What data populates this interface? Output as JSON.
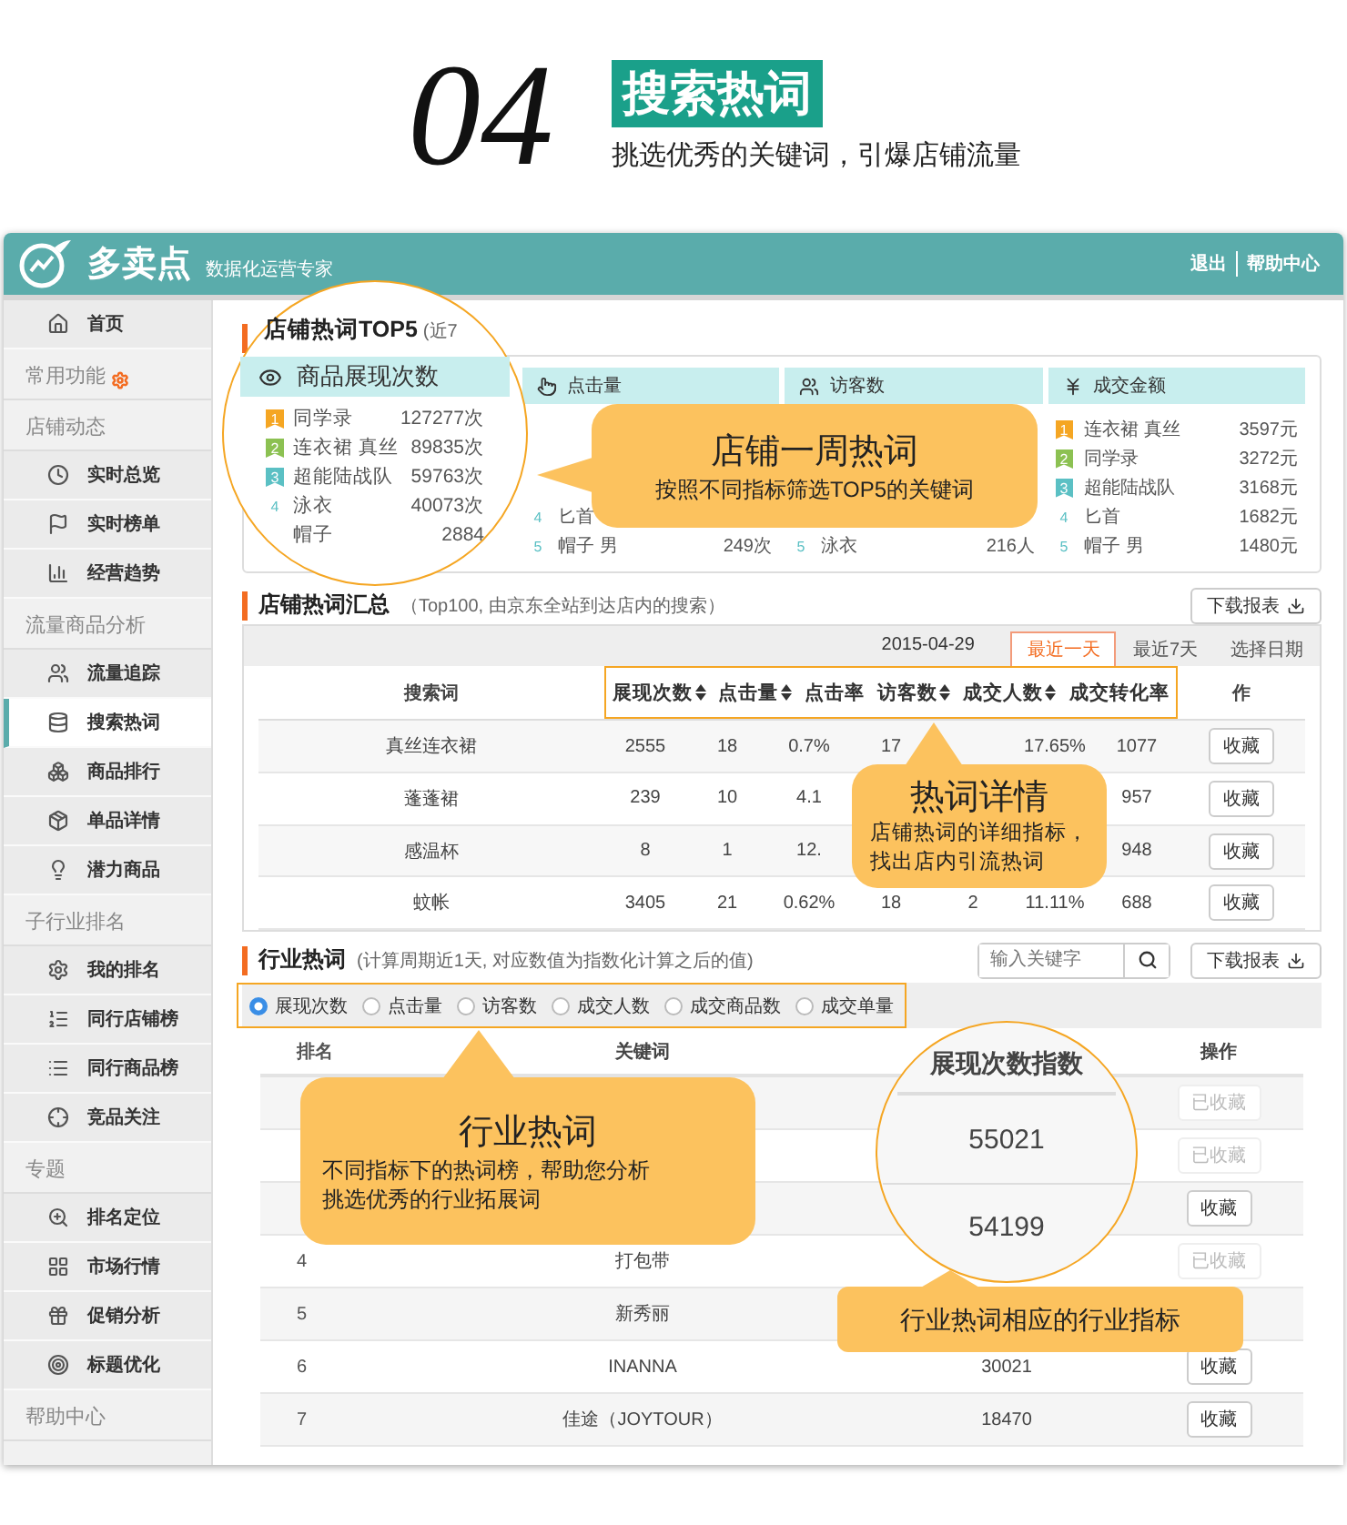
{
  "hero": {
    "number": "04",
    "title": "搜索热词",
    "subtitle": "挑选优秀的关键词，引爆店铺流量"
  },
  "topbar": {
    "brand": "多卖点",
    "tagline": "数据化运营专家",
    "links": [
      "退出",
      "帮助中心"
    ]
  },
  "sidebar": [
    {
      "kind": "item",
      "label": "首页",
      "selected": false
    },
    {
      "kind": "heading",
      "label": "常用功能",
      "gear": true
    },
    {
      "kind": "heading",
      "label": "店铺动态"
    },
    {
      "kind": "item",
      "label": "实时总览",
      "selected": false
    },
    {
      "kind": "item",
      "label": "实时榜单",
      "selected": false
    },
    {
      "kind": "item",
      "label": "经营趋势",
      "selected": false
    },
    {
      "kind": "heading",
      "label": "流量商品分析"
    },
    {
      "kind": "item",
      "label": "流量追踪",
      "selected": false
    },
    {
      "kind": "item",
      "label": "搜索热词",
      "selected": true
    },
    {
      "kind": "item",
      "label": "商品排行",
      "selected": false
    },
    {
      "kind": "item",
      "label": "单品详情",
      "selected": false
    },
    {
      "kind": "item",
      "label": "潜力商品",
      "selected": false
    },
    {
      "kind": "heading",
      "label": "子行业排名"
    },
    {
      "kind": "item",
      "label": "我的排名",
      "selected": false
    },
    {
      "kind": "item",
      "label": "同行店铺榜",
      "selected": false
    },
    {
      "kind": "item",
      "label": "同行商品榜",
      "selected": false
    },
    {
      "kind": "item",
      "label": "竞品关注",
      "selected": false
    },
    {
      "kind": "heading",
      "label": "专题"
    },
    {
      "kind": "item",
      "label": "排名定位",
      "selected": false
    },
    {
      "kind": "item",
      "label": "市场行情",
      "selected": false
    },
    {
      "kind": "item",
      "label": "促销分析",
      "selected": false
    },
    {
      "kind": "item",
      "label": "标题优化",
      "selected": false
    },
    {
      "kind": "heading",
      "label": "帮助中心"
    }
  ],
  "top5": {
    "title": "店铺热词TOP5",
    "note": "(近7",
    "columns": [
      {
        "title": "商品展现次数",
        "rows": [
          {
            "rank": "1",
            "color": "#f5a623",
            "name": "同学录",
            "value": "127277次"
          },
          {
            "rank": "2",
            "color": "#8cc152",
            "name": "连衣裙 真丝",
            "value": "89835次"
          },
          {
            "rank": "3",
            "color": "#5bc0c4",
            "name": "超能陆战队",
            "value": "59763次"
          },
          {
            "rank": "4",
            "name": "泳衣",
            "value": "40073次"
          },
          {
            "name": "帽子",
            "value": "2884"
          }
        ]
      },
      {
        "title": "点击量",
        "rows": [
          {
            "rank": "4",
            "name": "匕首"
          },
          {
            "rank": "5",
            "name": "帽子 男",
            "value": "249次"
          }
        ]
      },
      {
        "title": "访客数",
        "rows": [
          {
            "rank": "5",
            "name": "泳衣",
            "value": "216人"
          }
        ]
      },
      {
        "title": "成交金额",
        "rows": [
          {
            "rank": "1",
            "color": "#f5a623",
            "name": "连衣裙 真丝",
            "value": "3597元"
          },
          {
            "rank": "2",
            "color": "#8cc152",
            "name": "同学录",
            "value": "3272元"
          },
          {
            "rank": "3",
            "color": "#5bc0c4",
            "name": "超能陆战队",
            "value": "3168元"
          },
          {
            "rank": "4",
            "name": "匕首",
            "value": "1682元"
          },
          {
            "rank": "5",
            "name": "帽子 男",
            "value": "1480元"
          }
        ]
      }
    ],
    "callout": {
      "title": "店铺一周热词",
      "text": "按照不同指标筛选TOP5的关键词"
    }
  },
  "summary": {
    "title": "店铺热词汇总",
    "note": "（Top100, 由京东全站到达店内的搜索）",
    "download": "下载报表",
    "date": "2015-04-29",
    "ranges": [
      {
        "label": "最近一天",
        "selected": true
      },
      {
        "label": "最近7天",
        "selected": false
      },
      {
        "label": "选择日期",
        "selected": false
      }
    ],
    "keyword_header": "搜索词",
    "metric_headers": [
      {
        "label": "展现次数",
        "sortable": true
      },
      {
        "label": "点击量",
        "sortable": true
      },
      {
        "label": "点击率",
        "sortable": false
      },
      {
        "label": "访客数",
        "sortable": true
      },
      {
        "label": "成交人数",
        "sortable": true
      },
      {
        "label": "成交转化率",
        "sortable": false
      }
    ],
    "action_header": "作",
    "rows": [
      {
        "keyword": "真丝连衣裙",
        "cells": [
          "2555",
          "18",
          "0.7%",
          "17",
          null,
          "17.65%",
          "1077"
        ],
        "button": "收藏"
      },
      {
        "keyword": "蓬蓬裙",
        "cells": [
          "239",
          "10",
          "4.1",
          null,
          null,
          null,
          "957"
        ],
        "button": "收藏"
      },
      {
        "keyword": "感温杯",
        "cells": [
          "8",
          "1",
          "12.",
          null,
          null,
          null,
          "948"
        ],
        "button": "收藏"
      },
      {
        "keyword": "蚊帐",
        "cells": [
          "3405",
          "21",
          "0.62%",
          "18",
          "2",
          "11.11%",
          "688"
        ],
        "button": "收藏"
      }
    ],
    "callout": {
      "title": "热词详情",
      "text": "店铺热词的详细指标，找出店内引流热词"
    }
  },
  "industry": {
    "title": "行业热词",
    "note": "(计算周期近1天, 对应数值为指数化计算之后的值)",
    "search_placeholder": "输入关键字",
    "download": "下载报表",
    "metrics": [
      {
        "label": "展现次数",
        "selected": true
      },
      {
        "label": "点击量",
        "selected": false
      },
      {
        "label": "访客数",
        "selected": false
      },
      {
        "label": "成交人数",
        "selected": false
      },
      {
        "label": "成交商品数",
        "selected": false
      },
      {
        "label": "成交单量",
        "selected": false
      }
    ],
    "rank_header": "排名",
    "keyword_header": "关键词",
    "action_header": "操作",
    "lens": {
      "header": "展现次数指数",
      "values": [
        "55021",
        "54199"
      ]
    },
    "rows": [
      {
        "button": {
          "label": "已收藏",
          "saved": true
        }
      },
      {
        "button": {
          "label": "已收藏",
          "saved": true
        }
      },
      {
        "button": {
          "label": "收藏",
          "saved": false
        }
      },
      {
        "rank": "4",
        "keyword": "打包带",
        "button": {
          "label": "已收藏",
          "saved": true
        }
      },
      {
        "rank": "5",
        "keyword": "新秀丽"
      },
      {
        "rank": "6",
        "keyword": "INANNA",
        "value": "30021",
        "button": {
          "label": "收藏",
          "saved": false
        }
      },
      {
        "rank": "7",
        "keyword": "佳途（JOYTOUR）",
        "value": "18470",
        "button": {
          "label": "收藏",
          "saved": false
        }
      }
    ],
    "callout": {
      "title": "行业热词",
      "text": "不同指标下的热词榜，帮助您分析挑选优秀的行业拓展词"
    },
    "note_callout": {
      "text": "行业热词相应的行业指标"
    }
  }
}
